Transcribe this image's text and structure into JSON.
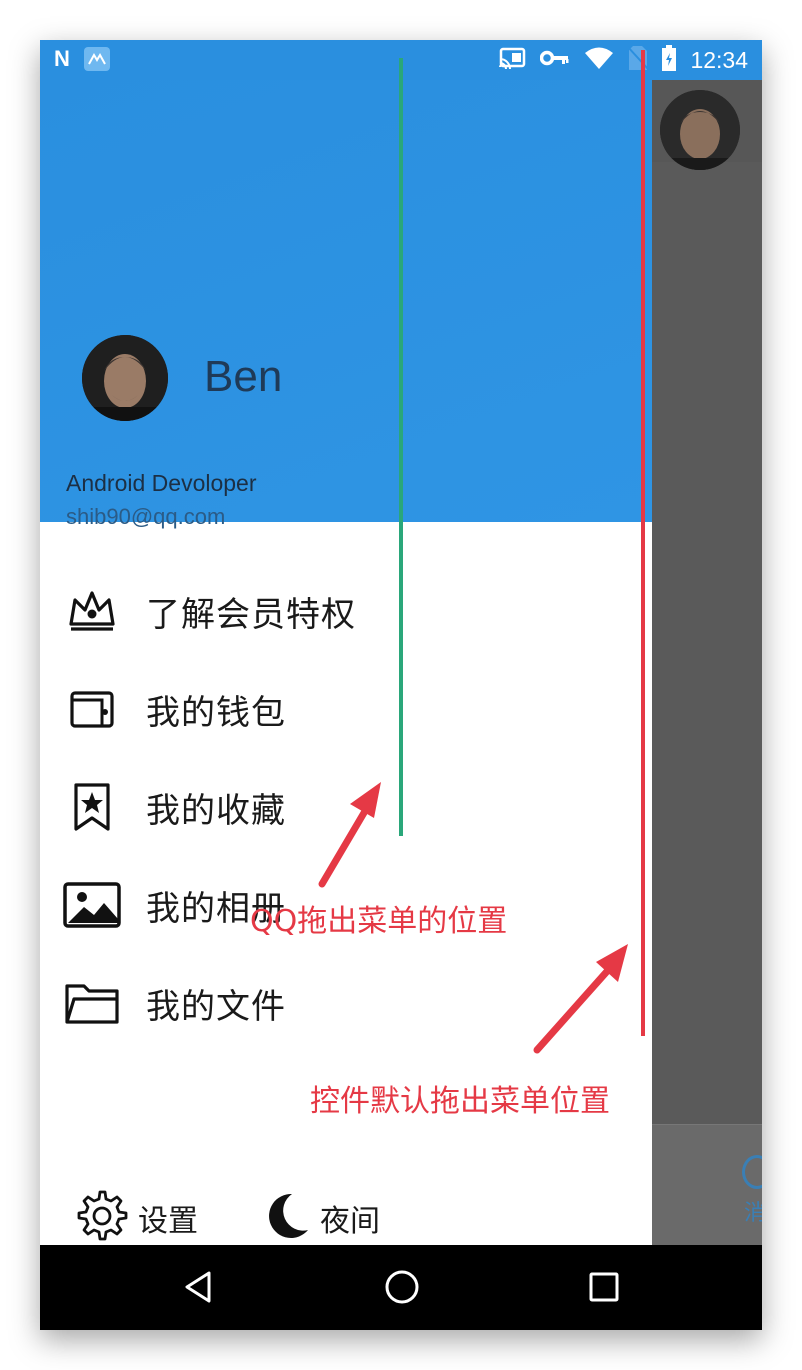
{
  "status_bar": {
    "time": "12:34",
    "left_icons": [
      "n-icon",
      "mi-icon"
    ],
    "right_icons": [
      "cast-icon",
      "key-icon",
      "wifi-icon",
      "no-sim-icon",
      "battery-icon"
    ],
    "n_glyph": "N"
  },
  "profile": {
    "name": "Ben",
    "role": "Android Devoloper",
    "email": "shib90@qq.com"
  },
  "menu": {
    "items": [
      {
        "label": "了解会员特权",
        "icon": "crown-icon"
      },
      {
        "label": "我的钱包",
        "icon": "wallet-icon"
      },
      {
        "label": "我的收藏",
        "icon": "bookmark-star-icon"
      },
      {
        "label": "我的相册",
        "icon": "photo-icon"
      },
      {
        "label": "我的文件",
        "icon": "folder-icon"
      }
    ]
  },
  "footer": {
    "settings_label": "设置",
    "night_label": "夜间"
  },
  "behind_content": {
    "tab_label": "消"
  },
  "annotations": {
    "qq_position": "QQ拖出菜单的位置",
    "default_position": "控件默认拖出菜单位置"
  },
  "colors": {
    "header_blue": "#2a8fdf",
    "annotation_red": "#e53945",
    "annotation_green": "#2aa77a"
  }
}
